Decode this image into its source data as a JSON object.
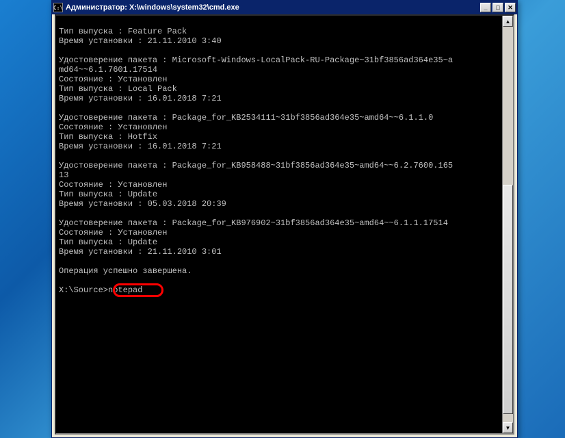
{
  "window": {
    "title": "Администратор: X:\\windows\\system32\\cmd.exe"
  },
  "titlebar_icon": "C:\\",
  "buttons": {
    "minimize": "_",
    "maximize": "□",
    "close": "✕"
  },
  "terminal": {
    "lines": {
      "l01": "Тип выпуска : Feature Pack",
      "l02": "Время установки : 21.11.2010 3:40",
      "l03": "",
      "l04": "Удостоверение пакета : Microsoft-Windows-LocalPack-RU-Package~31bf3856ad364e35~a",
      "l05": "md64~~6.1.7601.17514",
      "l06": "Состояние : Установлен",
      "l07": "Тип выпуска : Local Pack",
      "l08": "Время установки : 16.01.2018 7:21",
      "l09": "",
      "l10": "Удостоверение пакета : Package_for_KB2534111~31bf3856ad364e35~amd64~~6.1.1.0",
      "l11": "Состояние : Установлен",
      "l12": "Тип выпуска : Hotfix",
      "l13": "Время установки : 16.01.2018 7:21",
      "l14": "",
      "l15": "Удостоверение пакета : Package_for_KB958488~31bf3856ad364e35~amd64~~6.2.7600.165",
      "l16": "13",
      "l17": "Состояние : Установлен",
      "l18": "Тип выпуска : Update",
      "l19": "Время установки : 05.03.2018 20:39",
      "l20": "",
      "l21": "Удостоверение пакета : Package_for_KB976902~31bf3856ad364e35~amd64~~6.1.1.17514",
      "l22": "Состояние : Установлен",
      "l23": "Тип выпуска : Update",
      "l24": "Время установки : 21.11.2010 3:01",
      "l25": "",
      "l26": "Операция успешно завершена.",
      "l27": "",
      "prompt_path": "X:\\Source>",
      "prompt_command": "notepad"
    }
  }
}
